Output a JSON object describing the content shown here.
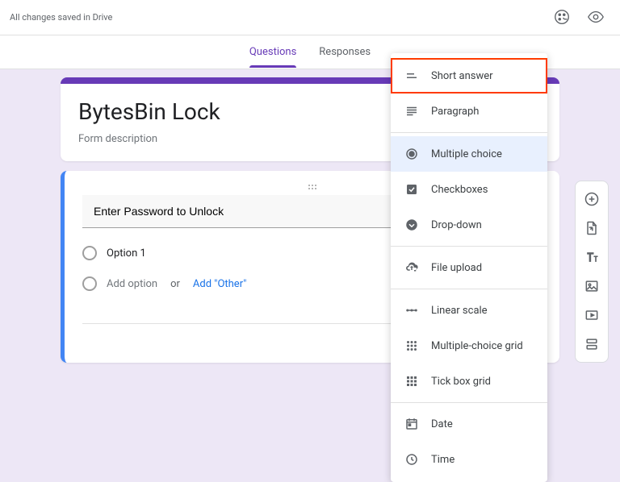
{
  "header": {
    "save_status": "All changes saved in Drive"
  },
  "tabs": {
    "questions": "Questions",
    "responses": "Responses"
  },
  "form": {
    "title": "BytesBin Lock",
    "description": "Form description"
  },
  "question": {
    "title": "Enter Password to Unlock",
    "option1": "Option 1",
    "add_option": "Add option",
    "or": "or",
    "add_other": "Add \"Other\""
  },
  "dropdown": {
    "short_answer": "Short answer",
    "paragraph": "Paragraph",
    "multiple_choice": "Multiple choice",
    "checkboxes": "Checkboxes",
    "dropdown": "Drop-down",
    "file_upload": "File upload",
    "linear_scale": "Linear scale",
    "mc_grid": "Multiple-choice grid",
    "tick_grid": "Tick box grid",
    "date": "Date",
    "time": "Time"
  }
}
